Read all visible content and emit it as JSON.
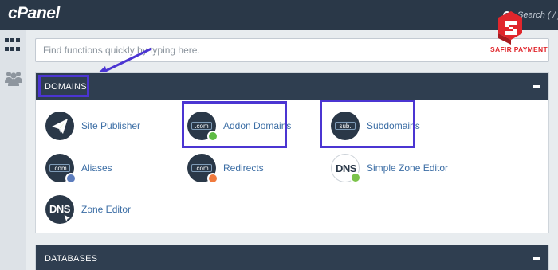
{
  "app": {
    "logo_text": "cPanel"
  },
  "top_search": {
    "text": "Search ( / )"
  },
  "sidebar": {
    "icons": [
      "grid-icon",
      "users-icon"
    ]
  },
  "search": {
    "placeholder": "Find functions quickly by typing here."
  },
  "sections": {
    "domains": {
      "title": "DOMAINS",
      "items": [
        {
          "label": "Site Publisher",
          "icon": "paper-plane-icon"
        },
        {
          "label": "Addon Domains",
          "icon": "addon-domain-icon",
          "icon_text": ".com"
        },
        {
          "label": "Subdomains",
          "icon": "subdomain-icon",
          "icon_text": "sub."
        },
        {
          "label": "Aliases",
          "icon": "alias-icon",
          "icon_text": ".com"
        },
        {
          "label": "Redirects",
          "icon": "redirect-icon",
          "icon_text": ".com"
        },
        {
          "label": "Simple Zone Editor",
          "icon": "dns-icon",
          "icon_text": "DNS"
        },
        {
          "label": "Zone Editor",
          "icon": "dns-icon",
          "icon_text": "DNS"
        }
      ]
    },
    "databases": {
      "title": "DATABASES"
    }
  },
  "watermark": {
    "text": "SAFIR PAYMENT"
  },
  "colors": {
    "header_bg": "#2a3848",
    "panel_head_bg": "#2f3e50",
    "highlight": "#4b35d2",
    "link": "#3c6ea5",
    "brand_red": "#e0262c"
  }
}
